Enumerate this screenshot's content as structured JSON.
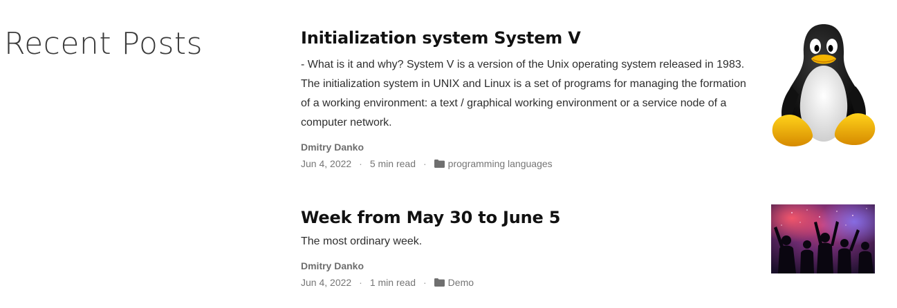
{
  "section": {
    "title": "Recent Posts"
  },
  "posts": [
    {
      "title": "Initialization system System V",
      "excerpt": "- What is it and why? System V is a version of the Unix operating system released in 1983. The initialization system in UNIX and Linux is a set of programs for managing the formation of a working environment: a text / graphical working environment or a service node of a computer network.",
      "author": "Dmitry Danko",
      "date": "Jun 4, 2022",
      "read_time": "5 min read",
      "separator": "·",
      "category": "programming languages",
      "category_icon": "folder-icon",
      "thumbnail": "linux-penguin-image"
    },
    {
      "title": "Week from May 30 to June 5",
      "excerpt": "The most ordinary week.",
      "author": "Dmitry Danko",
      "date": "Jun 4, 2022",
      "read_time": "1 min read",
      "separator": "·",
      "category": "Demo",
      "category_icon": "folder-icon",
      "thumbnail": "party-crowd-image"
    }
  ],
  "colors": {
    "heading": "#111111",
    "meta": "#757575",
    "section_title": "#3a3a3a"
  }
}
